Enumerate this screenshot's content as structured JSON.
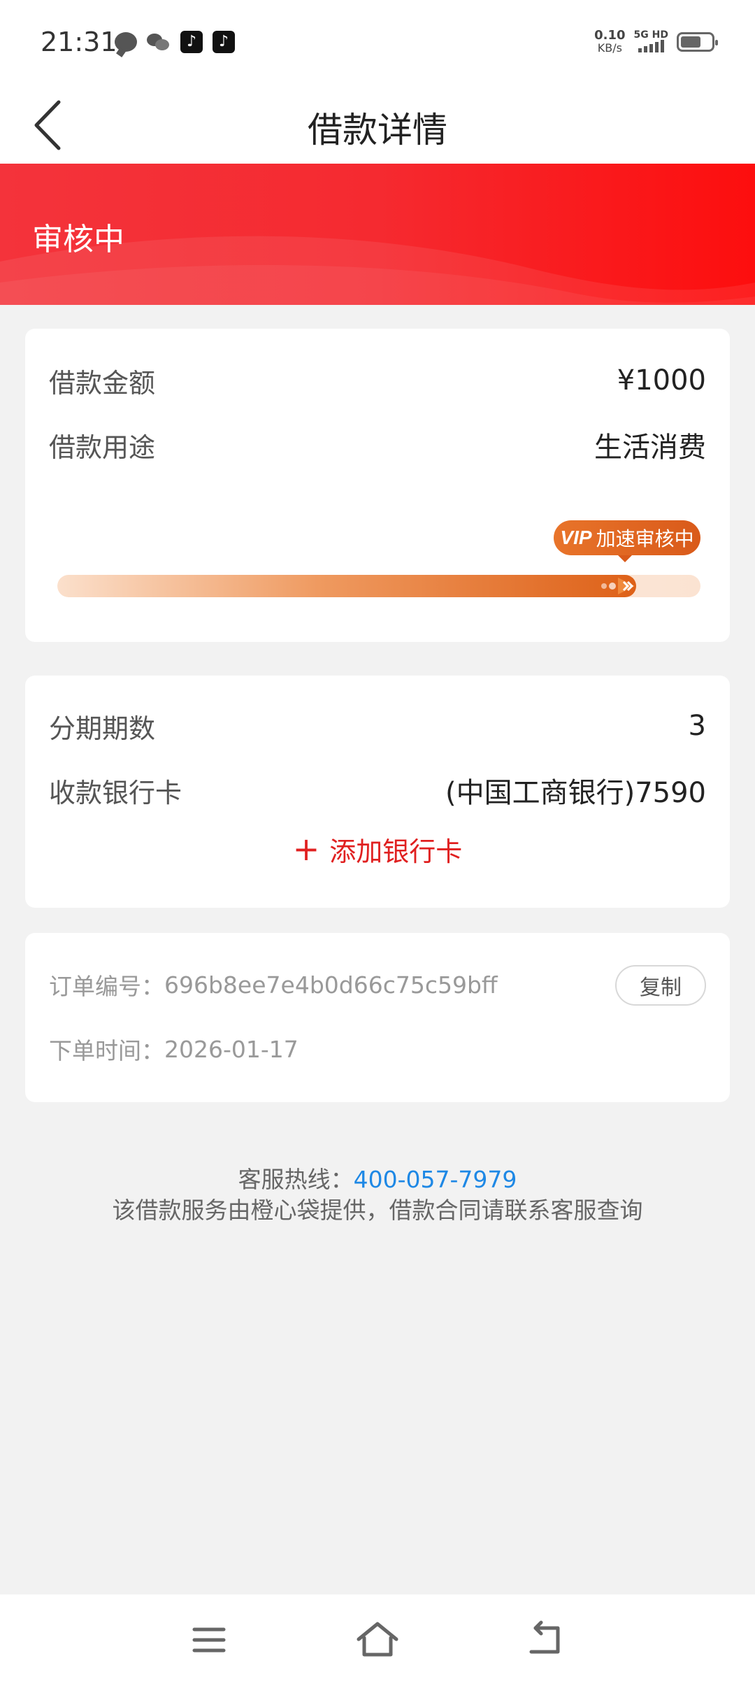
{
  "status_bar": {
    "time": "21:31",
    "net_speed": "0.10",
    "net_unit": "KB/s",
    "signal": "5G HD",
    "icons": [
      "chat-bubble-icon",
      "wechat-icon",
      "tiktok-icon",
      "tiktok-icon"
    ]
  },
  "header": {
    "title": "借款详情",
    "back_icon": "chevron-left-icon"
  },
  "banner": {
    "status": "审核中",
    "color_start": "#f4333b",
    "color_end": "#fd0e0e"
  },
  "loan": {
    "amount_label": "借款金额",
    "amount_value": "¥1000",
    "purpose_label": "借款用途",
    "purpose_value": "生活消费",
    "vip_prefix": "VIP",
    "vip_text": "加速审核中",
    "progress": 0.9
  },
  "installment": {
    "periods_label": "分期期数",
    "periods_value": "3",
    "bank_label": "收款银行卡",
    "bank_value": "(中国工商银行)7590",
    "add_plus": "+",
    "add_label": "添加银行卡"
  },
  "order": {
    "number_label": "订单编号：",
    "number_value": "696b8ee7e4b0d66c75c59bff",
    "copy_label": "复制",
    "time_label": "下单时间：",
    "time_value": "2026-01-17"
  },
  "footer": {
    "hotline_label": "客服热线：",
    "hotline_number": "400-057-7979",
    "notice": "该借款服务由橙心袋提供，借款合同请联系客服查询",
    "accent_color": "#1e88e5"
  },
  "bottom_nav": {
    "icons": [
      "menu-icon",
      "home-icon",
      "back-icon"
    ]
  }
}
